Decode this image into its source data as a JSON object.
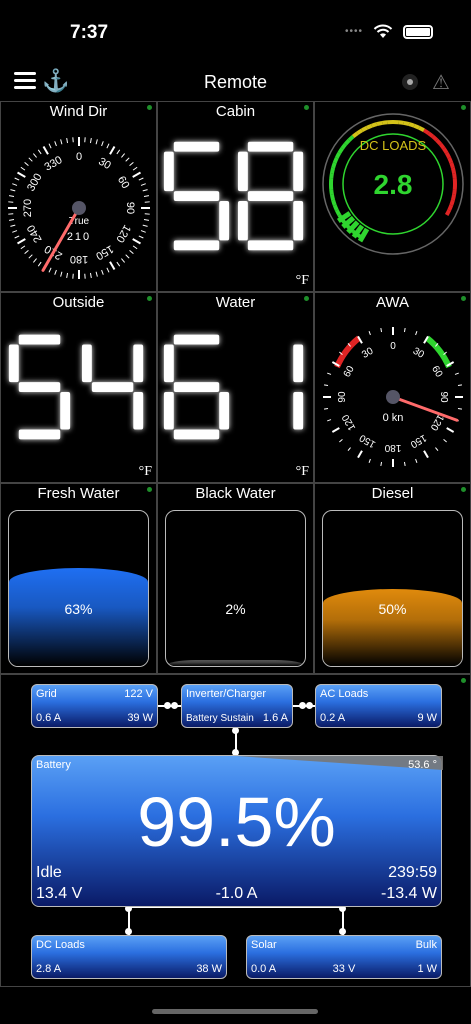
{
  "status": {
    "time": "7:37",
    "signal": "••••"
  },
  "nav": {
    "title": "Remote"
  },
  "wind_dir": {
    "label": "Wind Dir",
    "compass_labels": [
      "0",
      "30",
      "60",
      "90",
      "120",
      "150",
      "180",
      "210",
      "240",
      "270",
      "300",
      "330"
    ],
    "needle_deg": 210,
    "mode": "True",
    "value": "210"
  },
  "cabin": {
    "label": "Cabin",
    "value": "58",
    "unit": "°F"
  },
  "dc_loads_gauge": {
    "label": "DC LOADS",
    "value": "2.8",
    "level_fraction": 0.12
  },
  "outside": {
    "label": "Outside",
    "value": "54",
    "unit": "°F"
  },
  "water": {
    "label": "Water",
    "value": "61",
    "unit": "°F"
  },
  "awa": {
    "label": "AWA",
    "scale_labels": [
      "0",
      "30",
      "60",
      "90",
      "120",
      "150",
      "180",
      "150",
      "120",
      "90",
      "60",
      "30"
    ],
    "needle_deg": 110,
    "speed": "0 kn"
  },
  "tanks": [
    {
      "label": "Fresh Water",
      "percent_text": "63%",
      "level": 0.63,
      "color": "#1f6ff2"
    },
    {
      "label": "Black Water",
      "percent_text": "2%",
      "level": 0.02,
      "color": "#555555"
    },
    {
      "label": "Diesel",
      "percent_text": "50%",
      "level": 0.5,
      "color": "#e08a0c"
    }
  ],
  "power": {
    "grid": {
      "title": "Grid",
      "voltage": "122 V",
      "current": "0.6 A",
      "power": "39 W"
    },
    "inverter": {
      "title": "Inverter/Charger",
      "status": "Battery Sustain",
      "current": "1.6 A"
    },
    "ac_loads": {
      "title": "AC Loads",
      "current": "0.2 A",
      "power": "9 W"
    },
    "battery": {
      "title": "Battery",
      "temperature": "53.6 °",
      "soc": "99.5%",
      "state": "Idle",
      "time_remaining": "239:59",
      "voltage": "13.4 V",
      "current": "-1.0 A",
      "power": "-13.4 W",
      "soc_fraction": 0.995
    },
    "dc_loads": {
      "title": "DC Loads",
      "current": "2.8 A",
      "power": "38 W"
    },
    "solar": {
      "title": "Solar",
      "status": "Bulk",
      "current": "0.0 A",
      "voltage": "33 V",
      "power": "1 W"
    }
  },
  "colors": {
    "accent_blue": "#2b6fe0",
    "status_green": "#1e8f2a",
    "gauge_green": "#2fd52f",
    "gauge_red": "#e02424"
  }
}
